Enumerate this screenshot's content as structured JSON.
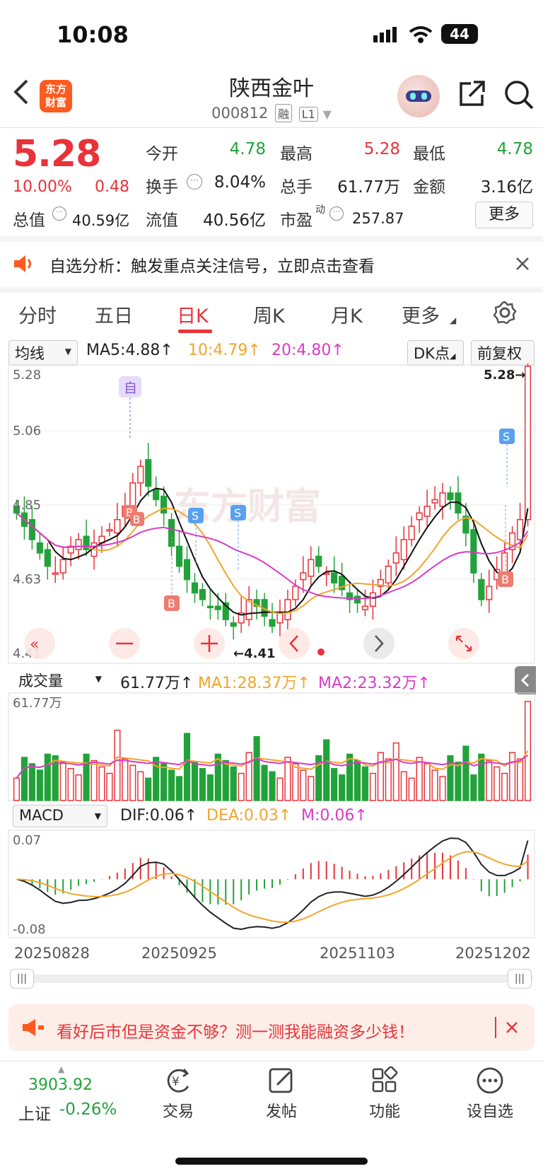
{
  "status_bar": {
    "time": "10:08",
    "battery": "44"
  },
  "header": {
    "title": "陕西金叶",
    "code": "000812",
    "tag1": "融",
    "tag2": "L1",
    "logo_line1": "东方",
    "logo_line2": "财富"
  },
  "quote": {
    "price": "5.28",
    "pct": "10.00%",
    "chg": "0.48",
    "open_label": "今开",
    "open": "4.78",
    "high_label": "最高",
    "high": "5.28",
    "low_label": "最低",
    "low": "4.78",
    "turnover_label": "换手",
    "turnover": "8.04%",
    "volume_label": "总手",
    "volume": "61.77万",
    "amount_label": "金额",
    "amount": "3.16亿",
    "mcap_label": "总值",
    "mcap": "40.59亿",
    "float_label": "流值",
    "float": "40.56亿",
    "pe_label": "市盈",
    "pe_sup": "动",
    "pe": "257.87",
    "more_label": "更多"
  },
  "alert": {
    "text": "自选分析：触发重点关注信号，立即点击查看"
  },
  "tabs": [
    "分时",
    "五日",
    "日K",
    "周K",
    "月K",
    "更多"
  ],
  "kline": {
    "ma_selector": "均线",
    "ma5": "MA5:4.88↑",
    "ma10": "10:4.79↑",
    "ma20": "20:4.80↑",
    "dk_label": "DK点",
    "fq_label": "前复权",
    "ylabels": [
      "5.28",
      "5.06",
      "4.85",
      "4.63",
      "4.41"
    ],
    "max_label": "5.28→",
    "min_label": "←4.41",
    "watermark": "东方财富",
    "self_marker": "自"
  },
  "volume": {
    "selector": "成交量",
    "val": "61.77万↑",
    "ma1": "MA1:28.37万↑",
    "ma2": "MA2:23.32万↑",
    "ymax": "61.77万"
  },
  "macd": {
    "selector": "MACD",
    "dif": "DIF:0.06↑",
    "dea": "DEA:0.03↑",
    "m": "M:0.06↑",
    "ymax": "0.07",
    "ymin": "-0.08"
  },
  "dates": [
    "20250828",
    "20250925",
    "20251103",
    "20251202"
  ],
  "promo": {
    "text": "看好后市但是资金不够？测一测我能融资多少钱！"
  },
  "bottom": {
    "index_value": "3903.92",
    "index_name": "上证",
    "index_chg": "-0.26%",
    "items": [
      "交易",
      "发帖",
      "功能",
      "设自选"
    ]
  },
  "colors": {
    "up": "#e8333a",
    "down": "#22a23a",
    "ma5": "#111111",
    "ma10": "#f2a52b",
    "ma20": "#d93ac7",
    "accent": "#ff5a1f"
  }
}
